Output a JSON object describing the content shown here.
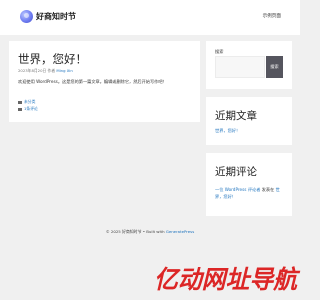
{
  "header": {
    "site_title": "好商知时节",
    "nav_link": "示例页面"
  },
  "post": {
    "title": "世界，您好！",
    "meta_date": "2023年8月20日",
    "meta_by": "作者",
    "meta_author": "Ming Xin",
    "body": "欢迎使用 WordPress。这是您的第一篇文章。编辑或删除它，然后开始写作吧！",
    "category_label": "未分类",
    "comment_label": "1条评论"
  },
  "sidebar": {
    "search_label": "搜索",
    "search_placeholder": "",
    "search_button": "搜索",
    "recent_posts_title": "近期文章",
    "recent_post_link": "世界，您好！",
    "recent_comments_title": "近期评论",
    "comment_author": "一位 WordPress 评论者",
    "comment_on": "发表在",
    "comment_post": "世界，您好！"
  },
  "footer": {
    "copyright": "© 2025 好商知时节 • Built with",
    "builder": "GeneratePress"
  },
  "watermark": {
    "text": "亿动网址导航",
    "color": "#dc2626"
  }
}
